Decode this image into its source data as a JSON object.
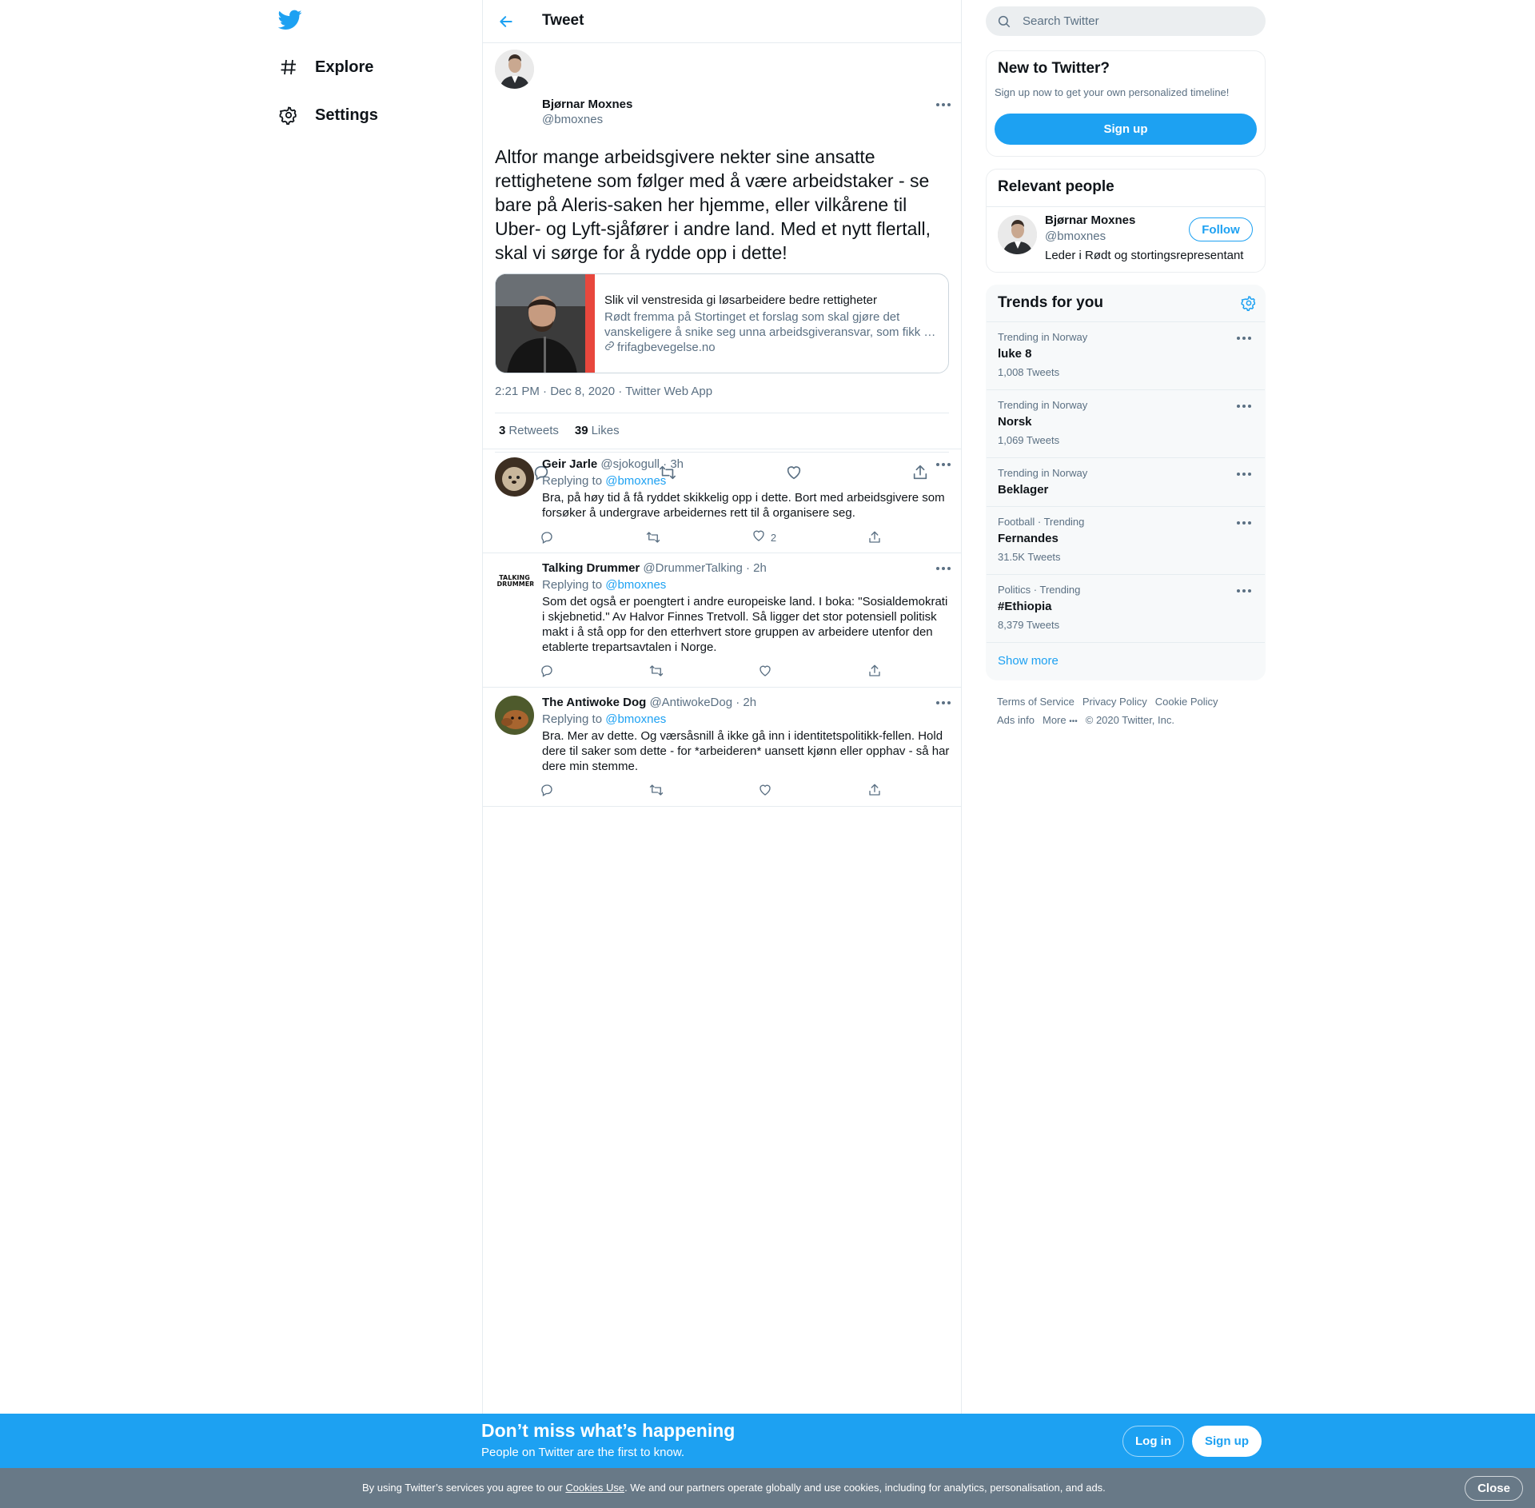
{
  "nav": {
    "items": [
      {
        "label": "Explore",
        "icon": "hashtag-icon"
      },
      {
        "label": "Settings",
        "icon": "gear-icon"
      }
    ]
  },
  "header": {
    "title": "Tweet"
  },
  "main_tweet": {
    "name": "Bjørnar Moxnes",
    "handle": "@bmoxnes",
    "text": "Altfor mange arbeidsgivere nekter sine ansatte rettighetene som følger med å være arbeidstaker - se bare på Aleris-saken her hjemme, eller vilkårene til Uber- og Lyft-sjåfører i andre land. Med et nytt flertall, skal vi sørge for å rydde opp i dette!",
    "card": {
      "title": "Slik vil venstresida gi løsarbeidere bedre rettigheter",
      "description": "Rødt fremma på Stortinget et forslag som skal gjøre det vanskeligere å snike seg unna arbeidsgiveransvar, som fikk …",
      "link": "frifagbevegelse.no"
    },
    "timestamp": "2:21 PM · Dec 8, 2020 · Twitter Web App",
    "retweets_count": "3",
    "retweets_label": "Retweets",
    "likes_count": "39",
    "likes_label": "Likes"
  },
  "replies": [
    {
      "name": "Geir Jarle",
      "handle": "@sjokogull",
      "time": "· 3h",
      "replying_label": "Replying to",
      "replying_to": "@bmoxnes",
      "text": "Bra, på høy tid å få ryddet skikkelig opp i dette. Bort med arbeidsgivere som forsøker å undergrave arbeidernes rett til å organisere seg.",
      "likes": "2"
    },
    {
      "name": "Talking Drummer",
      "handle": "@DrummerTalking",
      "time": "· 2h",
      "replying_label": "Replying to",
      "replying_to": "@bmoxnes",
      "text": "Som det også er poengtert i andre europeiske land. I boka: \"Sosialdemokrati i skjebnetid.\" Av Halvor Finnes Tretvoll. Så ligger det stor potensiell politisk makt i å stå opp for den etterhvert store gruppen av arbeidere utenfor den etablerte trepartsavtalen i Norge.",
      "likes": "",
      "avatar_text": "TALKING DRUMMER"
    },
    {
      "name": "The Antiwoke Dog",
      "handle": "@AntiwokeDog",
      "time": "· 2h",
      "replying_label": "Replying to",
      "replying_to": "@bmoxnes",
      "text": "Bra. Mer av dette. Og værsåsnill å ikke gå inn i identitetspolitikk-fellen. Hold dere til saker som dette - for *arbeideren* uansett kjønn eller opphav - så har dere min stemme.",
      "likes": ""
    }
  ],
  "search": {
    "placeholder": "Search Twitter"
  },
  "new_to_twitter": {
    "title": "New to Twitter?",
    "subtitle": "Sign up now to get your own personalized timeline!",
    "button": "Sign up"
  },
  "relevant_people": {
    "title": "Relevant people",
    "name": "Bjørnar Moxnes",
    "handle": "@bmoxnes",
    "bio": "Leder i Rødt og stortingsrepresentant",
    "follow_label": "Follow"
  },
  "trends": {
    "title": "Trends for you",
    "items": [
      {
        "meta": "Trending in Norway",
        "name": "luke 8",
        "count": "1,008 Tweets"
      },
      {
        "meta": "Trending in Norway",
        "name": "Norsk",
        "count": "1,069 Tweets"
      },
      {
        "meta": "Trending in Norway",
        "name": "Beklager",
        "count": ""
      },
      {
        "meta": "Football · Trending",
        "name": "Fernandes",
        "count": "31.5K Tweets"
      },
      {
        "meta": "Politics · Trending",
        "name": "#Ethiopia",
        "count": "8,379 Tweets"
      }
    ],
    "show_more": "Show more"
  },
  "footer": {
    "terms": "Terms of Service",
    "privacy": "Privacy Policy",
    "cookie": "Cookie Policy",
    "ads": "Ads info",
    "more": "More",
    "copyright": "© 2020 Twitter, Inc."
  },
  "bottom_bar": {
    "headline": "Don’t miss what’s happening",
    "subline": "People on Twitter are the first to know.",
    "login": "Log in",
    "signup": "Sign up"
  },
  "cookie_bar": {
    "text_before": "By using Twitter’s services you agree to our ",
    "link": "Cookies Use",
    "text_after": ". We and our partners operate globally and use cookies, including for analytics, personalisation, and ads.",
    "close": "Close"
  },
  "colors": {
    "accent": "#1da1f2",
    "text": "#0f1419",
    "secondary": "#5b7083",
    "border": "#e6ecf0"
  }
}
